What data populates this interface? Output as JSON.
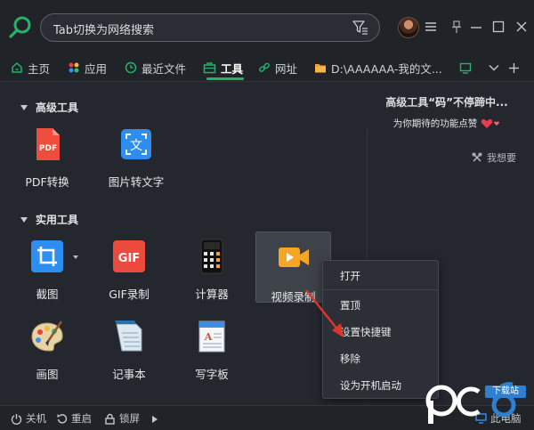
{
  "search": {
    "placeholder": "Tab切换为网络搜索"
  },
  "tabs": {
    "home": "主页",
    "apps": "应用",
    "recent": "最近文件",
    "tools": "工具",
    "url": "网址",
    "folder": "D:\\AAAAAA-我的文..."
  },
  "sections": {
    "advanced": "高级工具",
    "practical": "实用工具"
  },
  "tools": {
    "pdf": "PDF转换",
    "img2txt": "图片转文字",
    "screenshot": "截图",
    "gif": "GIF录制",
    "calc": "计算器",
    "video": "视频录制",
    "paint": "画图",
    "notepad": "记事本",
    "wordpad": "写字板"
  },
  "icon_text": {
    "pdf": "PDF",
    "img2txt": "文",
    "gif": "GIF"
  },
  "promo": {
    "title_pre": "高级工具",
    "title_em": "“码”",
    "title_post": "不停蹄中...",
    "subtitle": "为你期待的功能点赞",
    "wish": "我想要"
  },
  "context_menu": {
    "open": "打开",
    "pin": "置顶",
    "hotkey": "设置快捷键",
    "remove": "移除",
    "startup": "设为开机启动"
  },
  "bottom": {
    "shutdown": "关机",
    "restart": "重启",
    "lock": "锁屏",
    "pc": "此电脑"
  },
  "watermark": {
    "badge": "下载站"
  },
  "colors": {
    "accent": "#23b36b",
    "background": "#24272d",
    "red_arrow": "#e0342b"
  }
}
